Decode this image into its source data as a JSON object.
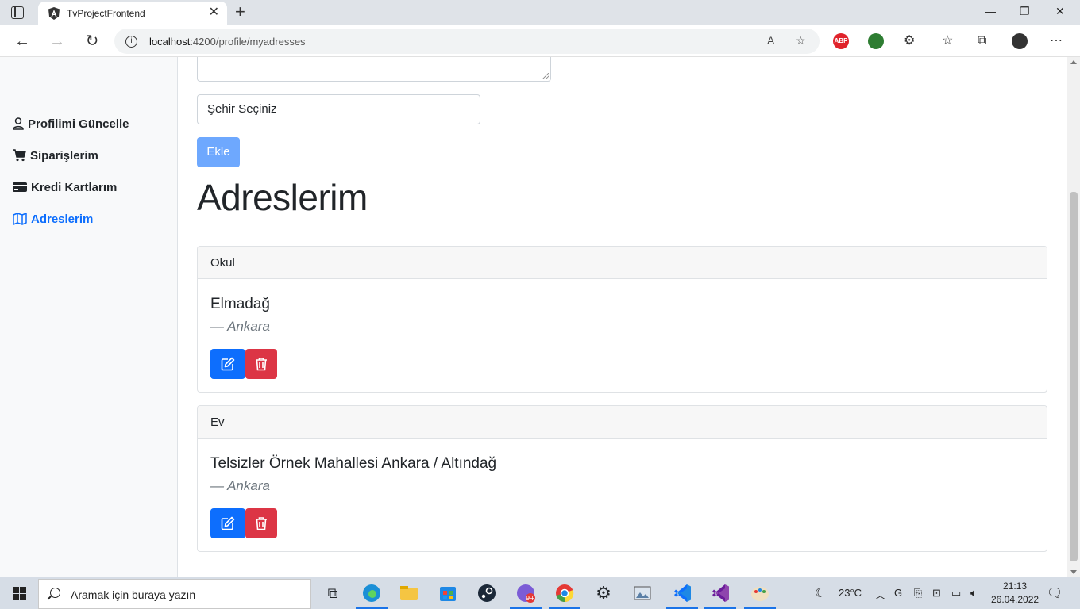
{
  "browser": {
    "tab_title": "TvProjectFrontend",
    "new_tab_symbol": "+",
    "url_host": "localhost",
    "url_rest": ":4200/profile/myadresses"
  },
  "sidebar": {
    "items": [
      {
        "label": "Profilimi Güncelle",
        "icon": "user-icon",
        "active": false
      },
      {
        "label": "Siparişlerim",
        "icon": "cart-icon",
        "active": false
      },
      {
        "label": "Kredi Kartlarım",
        "icon": "credit-card-icon",
        "active": false
      },
      {
        "label": "Adreslerim",
        "icon": "map-icon",
        "active": true
      }
    ]
  },
  "form": {
    "city_select_value": "Şehir Seçiniz",
    "add_button_label": "Ekle"
  },
  "main": {
    "heading": "Adreslerim",
    "addresses": [
      {
        "name": "Okul",
        "address": "Elmadağ",
        "city": "— Ankara"
      },
      {
        "name": "Ev",
        "address": "Telsizler Örnek Mahallesi Ankara / Altındağ",
        "city": "— Ankara"
      }
    ]
  },
  "taskbar": {
    "search_placeholder": "Aramak için buraya yazın",
    "temperature": "23°C",
    "time": "21:13",
    "date": "26.04.2022",
    "badge": "9+"
  },
  "colors": {
    "primary": "#0d6efd",
    "danger": "#dc3545",
    "disabled_primary": "#6ea8fe"
  }
}
